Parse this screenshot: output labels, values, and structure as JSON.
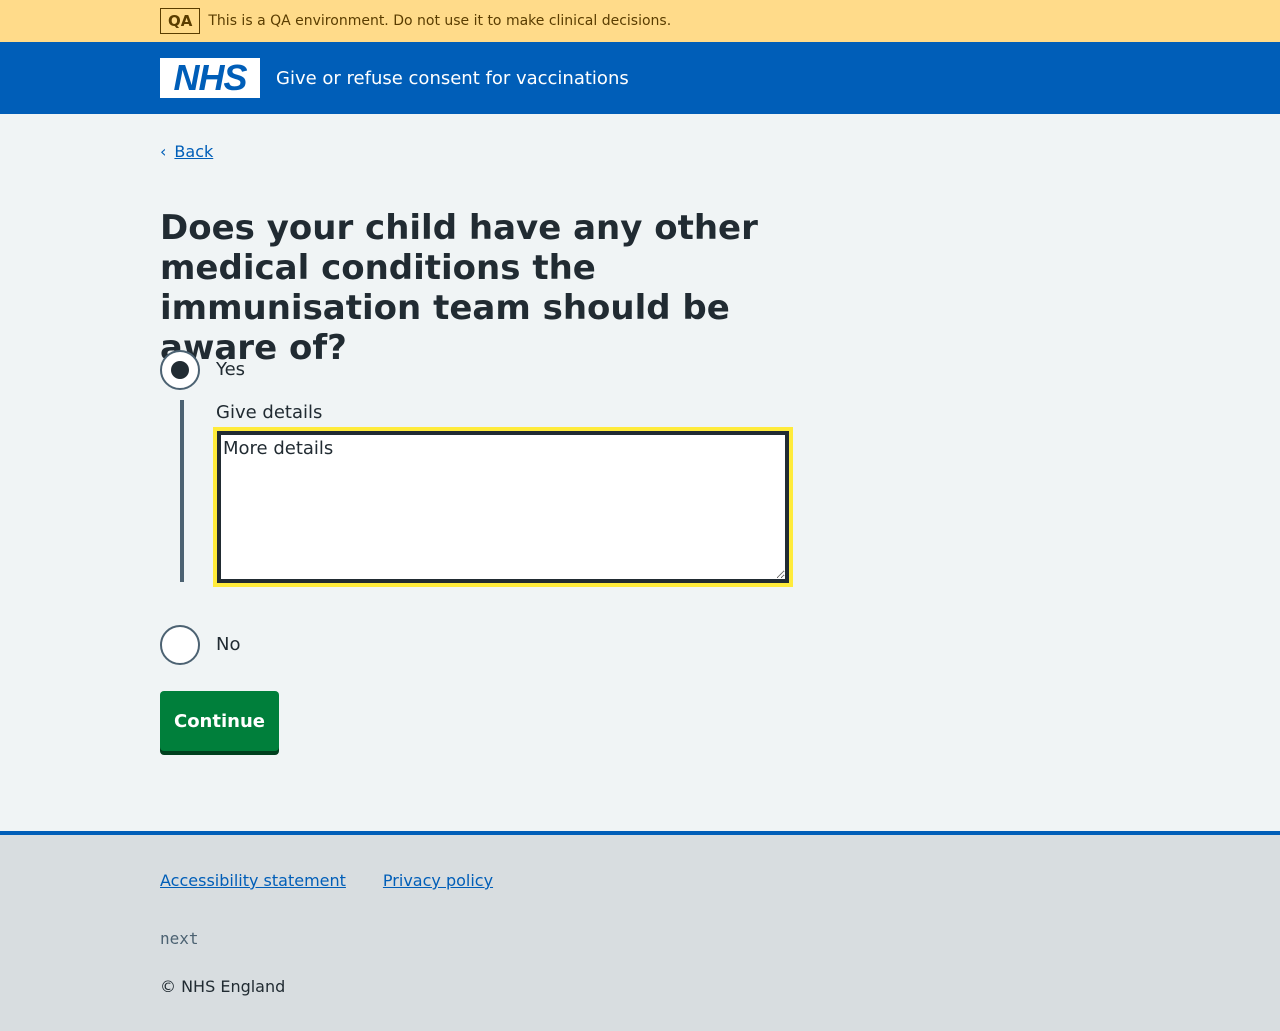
{
  "qa_banner": {
    "tag": "QA",
    "message": "This is a QA environment. Do not use it to make clinical decisions."
  },
  "header": {
    "logo_text": "NHS",
    "service_name": "Give or refuse consent for vaccinations"
  },
  "back_link": {
    "label": "Back"
  },
  "question": {
    "title": "Does your child have any other medical conditions the immunisation team should be aware of?",
    "options": [
      {
        "label": "Yes",
        "checked": true
      },
      {
        "label": "No",
        "checked": false
      }
    ],
    "details": {
      "label": "Give details",
      "value": "More details"
    }
  },
  "continue_button": {
    "label": "Continue"
  },
  "footer": {
    "links": [
      "Accessibility statement",
      "Privacy policy"
    ],
    "version": "next",
    "copyright": "© NHS England"
  },
  "colors": {
    "brand_blue": "#005eb8",
    "qa_banner": "#ffdb8a",
    "button_green": "#007f3b",
    "focus_yellow": "#ffeb3b"
  }
}
